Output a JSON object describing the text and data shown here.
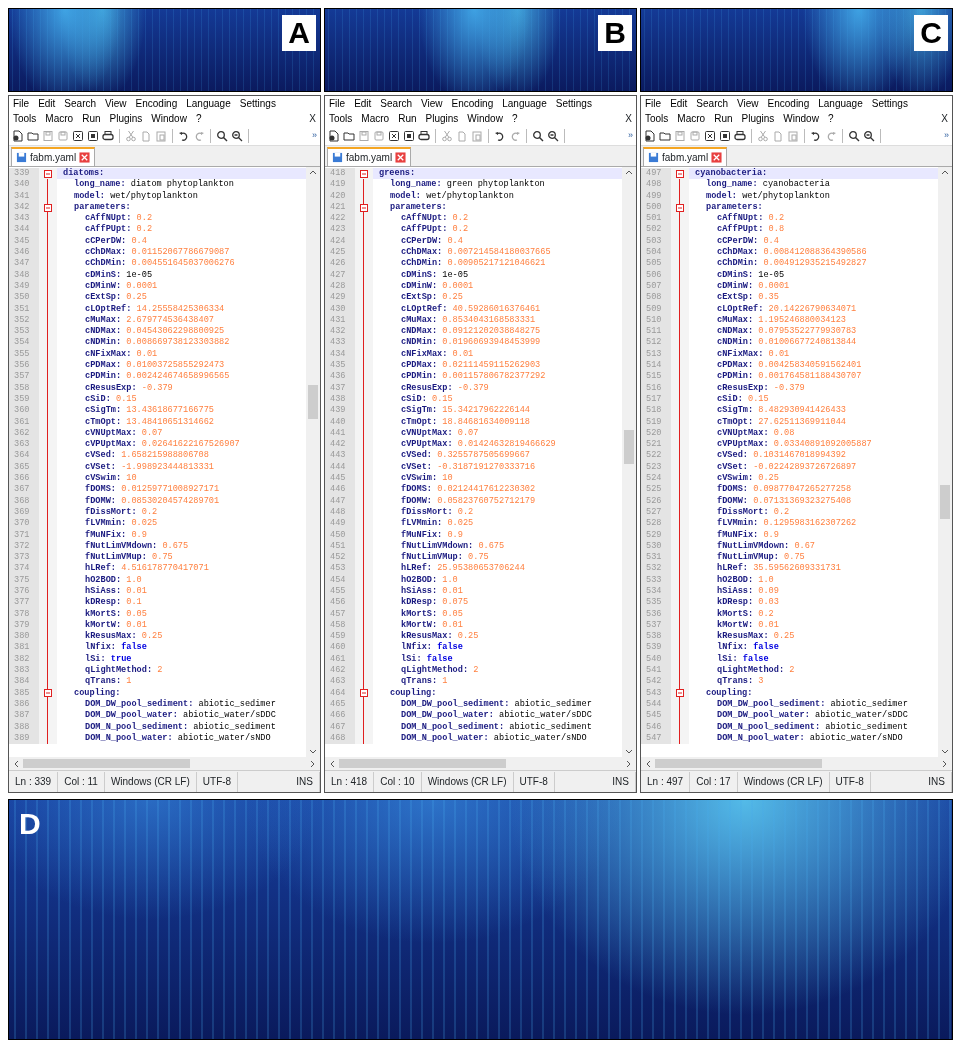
{
  "panels": [
    {
      "label": "A",
      "editor": {
        "menu_rows": [
          [
            "File",
            "Edit",
            "Search",
            "View",
            "Encoding",
            "Language",
            "Settings"
          ],
          [
            "Tools",
            "Macro",
            "Run",
            "Plugins",
            "Window",
            "?"
          ]
        ],
        "close": "X",
        "toolbar_more": "»",
        "tab": {
          "label": "fabm.yaml"
        },
        "code": {
          "num": "339",
          "key": "diatoms:",
          "kind": "section",
          "current": true,
          "children": [
            {
              "num": "340",
              "key": "long_name:",
              "value": "diatom phytoplankton",
              "kind": "text"
            },
            {
              "num": "341",
              "key": "model:",
              "value": "wet/phytoplankton",
              "kind": "text"
            },
            {
              "num": "342",
              "key": "parameters:",
              "kind": "section",
              "children": [
                {
                  "num": "343",
                  "key": "cAffNUpt:",
                  "value": "0.2",
                  "kind": "number"
                },
                {
                  "num": "344",
                  "key": "cAffPUpt:",
                  "value": "0.2",
                  "kind": "number"
                },
                {
                  "num": "345",
                  "key": "cCPerDW:",
                  "value": "0.4",
                  "kind": "number"
                },
                {
                  "num": "346",
                  "key": "cChDMax:",
                  "value": "0.01152067786679087",
                  "kind": "number"
                },
                {
                  "num": "347",
                  "key": "cChDMin:",
                  "value": "0.004551645037006276",
                  "kind": "number"
                },
                {
                  "num": "348",
                  "key": "cDMinS:",
                  "value": "1e-05",
                  "kind": "text"
                },
                {
                  "num": "349",
                  "key": "cDMinW:",
                  "value": "0.0001",
                  "kind": "number"
                },
                {
                  "num": "350",
                  "key": "cExtSp:",
                  "value": "0.25",
                  "kind": "number"
                },
                {
                  "num": "351",
                  "key": "cLOptRef:",
                  "value": "14.25558425306334",
                  "kind": "number"
                },
                {
                  "num": "352",
                  "key": "cMuMax:",
                  "value": "2.679774536438407",
                  "kind": "number"
                },
                {
                  "num": "353",
                  "key": "cNDMax:",
                  "value": "0.04543062298800925",
                  "kind": "number"
                },
                {
                  "num": "354",
                  "key": "cNDMin:",
                  "value": "0.008669738123303882",
                  "kind": "number"
                },
                {
                  "num": "355",
                  "key": "cNFixMax:",
                  "value": "0.01",
                  "kind": "number"
                },
                {
                  "num": "356",
                  "key": "cPDMax:",
                  "value": "0.01003725855292473",
                  "kind": "number"
                },
                {
                  "num": "357",
                  "key": "cPDMin:",
                  "value": "0.002424674658996565",
                  "kind": "number"
                },
                {
                  "num": "358",
                  "key": "cResusExp:",
                  "value": "-0.379",
                  "kind": "number"
                },
                {
                  "num": "359",
                  "key": "cSiD:",
                  "value": "0.15",
                  "kind": "number"
                },
                {
                  "num": "360",
                  "key": "cSigTm:",
                  "value": "13.43618677166775",
                  "kind": "number"
                },
                {
                  "num": "361",
                  "key": "cTmOpt:",
                  "value": "13.48410651314662",
                  "kind": "number"
                },
                {
                  "num": "362",
                  "key": "cVNUptMax:",
                  "value": "0.07",
                  "kind": "number"
                },
                {
                  "num": "363",
                  "key": "cVPUptMax:",
                  "value": "0.02641622167526907",
                  "kind": "number"
                },
                {
                  "num": "364",
                  "key": "cVSed:",
                  "value": "1.658215988806708",
                  "kind": "number"
                },
                {
                  "num": "365",
                  "key": "cVSet:",
                  "value": "-1.998923444813331",
                  "kind": "number"
                },
                {
                  "num": "366",
                  "key": "cVSwim:",
                  "value": "10",
                  "kind": "number"
                },
                {
                  "num": "367",
                  "key": "fDOMS:",
                  "value": "0.01259771008927171",
                  "kind": "number"
                },
                {
                  "num": "368",
                  "key": "fDOMW:",
                  "value": "0.08530204574289701",
                  "kind": "number"
                },
                {
                  "num": "369",
                  "key": "fDissMort:",
                  "value": "0.2",
                  "kind": "number"
                },
                {
                  "num": "370",
                  "key": "fLVMmin:",
                  "value": "0.025",
                  "kind": "number"
                },
                {
                  "num": "371",
                  "key": "fMuNFix:",
                  "value": "0.9",
                  "kind": "number"
                },
                {
                  "num": "372",
                  "key": "fNutLimVMdown:",
                  "value": "0.675",
                  "kind": "number"
                },
                {
                  "num": "373",
                  "key": "fNutLimVMup:",
                  "value": "0.75",
                  "kind": "number"
                },
                {
                  "num": "374",
                  "key": "hLRef:",
                  "value": "4.516178770417071",
                  "kind": "number"
                },
                {
                  "num": "375",
                  "key": "hO2BOD:",
                  "value": "1.0",
                  "kind": "number"
                },
                {
                  "num": "376",
                  "key": "hSiAss:",
                  "value": "0.01",
                  "kind": "number"
                },
                {
                  "num": "377",
                  "key": "kDResp:",
                  "value": "0.1",
                  "kind": "number"
                },
                {
                  "num": "378",
                  "key": "kMortS:",
                  "value": "0.05",
                  "kind": "number"
                },
                {
                  "num": "379",
                  "key": "kMortW:",
                  "value": "0.01",
                  "kind": "number"
                },
                {
                  "num": "380",
                  "key": "kResusMax:",
                  "value": "0.25",
                  "kind": "number"
                },
                {
                  "num": "381",
                  "key": "lNfix:",
                  "value": "false",
                  "kind": "bool"
                },
                {
                  "num": "382",
                  "key": "lSi:",
                  "value": "true",
                  "kind": "bool"
                },
                {
                  "num": "383",
                  "key": "qLightMethod:",
                  "value": "2",
                  "kind": "number"
                },
                {
                  "num": "384",
                  "key": "qTrans:",
                  "value": "1",
                  "kind": "number"
                }
              ]
            },
            {
              "num": "385",
              "key": "coupling:",
              "kind": "section",
              "children": [
                {
                  "num": "386",
                  "key": "DOM_DW_pool_sediment:",
                  "value": "abiotic_sedimer",
                  "kind": "text"
                },
                {
                  "num": "387",
                  "key": "DOM_DW_pool_water:",
                  "value": "abiotic_water/sDDC",
                  "kind": "text"
                },
                {
                  "num": "388",
                  "key": "DOM_N_pool_sediment:",
                  "value": "abiotic_sediment",
                  "kind": "text"
                },
                {
                  "num": "389",
                  "key": "DOM_N_pool_water:",
                  "value": "abiotic_water/sNDO",
                  "kind": "text"
                }
              ]
            }
          ]
        },
        "status": [
          "Ln : 339",
          "Col : 11",
          "Windows (CR LF)",
          "UTF-8",
          "INS"
        ]
      }
    },
    {
      "label": "B",
      "editor": {
        "menu_rows": [
          [
            "File",
            "Edit",
            "Search",
            "View",
            "Encoding",
            "Language",
            "Settings"
          ],
          [
            "Tools",
            "Macro",
            "Run",
            "Plugins",
            "Window",
            "?"
          ]
        ],
        "close": "X",
        "toolbar_more": "»",
        "tab": {
          "label": "fabm.yaml"
        },
        "code": {
          "num": "418",
          "key": "greens:",
          "kind": "section",
          "current": true,
          "children": [
            {
              "num": "419",
              "key": "long_name:",
              "value": "green phytoplankton",
              "kind": "text"
            },
            {
              "num": "420",
              "key": "model:",
              "value": "wet/phytoplankton",
              "kind": "text"
            },
            {
              "num": "421",
              "key": "parameters:",
              "kind": "section",
              "children": [
                {
                  "num": "422",
                  "key": "cAffNUpt:",
                  "value": "0.2",
                  "kind": "number"
                },
                {
                  "num": "423",
                  "key": "cAffPUpt:",
                  "value": "0.2",
                  "kind": "number"
                },
                {
                  "num": "424",
                  "key": "cCPerDW:",
                  "value": "0.4",
                  "kind": "number"
                },
                {
                  "num": "425",
                  "key": "cChDMax:",
                  "value": "0.007214584180037665",
                  "kind": "number"
                },
                {
                  "num": "426",
                  "key": "cChDMin:",
                  "value": "0.00905217121046621",
                  "kind": "number"
                },
                {
                  "num": "427",
                  "key": "cDMinS:",
                  "value": "1e-05",
                  "kind": "text"
                },
                {
                  "num": "428",
                  "key": "cDMinW:",
                  "value": "0.0001",
                  "kind": "number"
                },
                {
                  "num": "429",
                  "key": "cExtSp:",
                  "value": "0.25",
                  "kind": "number"
                },
                {
                  "num": "430",
                  "key": "cLOptRef:",
                  "value": "40.59286016376461",
                  "kind": "number"
                },
                {
                  "num": "431",
                  "key": "cMuMax:",
                  "value": "0.8534043168583331",
                  "kind": "number"
                },
                {
                  "num": "432",
                  "key": "cNDMax:",
                  "value": "0.09121202038848275",
                  "kind": "number"
                },
                {
                  "num": "433",
                  "key": "cNDMin:",
                  "value": "0.01960693948453999",
                  "kind": "number"
                },
                {
                  "num": "434",
                  "key": "cNFixMax:",
                  "value": "0.01",
                  "kind": "number"
                },
                {
                  "num": "435",
                  "key": "cPDMax:",
                  "value": "0.02111459115262903",
                  "kind": "number"
                },
                {
                  "num": "436",
                  "key": "cPDMin:",
                  "value": "0.001157806782377292",
                  "kind": "number"
                },
                {
                  "num": "437",
                  "key": "cResusExp:",
                  "value": "-0.379",
                  "kind": "number"
                },
                {
                  "num": "438",
                  "key": "cSiD:",
                  "value": "0.15",
                  "kind": "number"
                },
                {
                  "num": "439",
                  "key": "cSigTm:",
                  "value": "15.34217962226144",
                  "kind": "number"
                },
                {
                  "num": "440",
                  "key": "cTmOpt:",
                  "value": "18.84681634009118",
                  "kind": "number"
                },
                {
                  "num": "441",
                  "key": "cVNUptMax:",
                  "value": "0.07",
                  "kind": "number"
                },
                {
                  "num": "442",
                  "key": "cVPUptMax:",
                  "value": "0.01424632819466629",
                  "kind": "number"
                },
                {
                  "num": "443",
                  "key": "cVSed:",
                  "value": "0.3255787505699667",
                  "kind": "number"
                },
                {
                  "num": "444",
                  "key": "cVSet:",
                  "value": "-0.3187191270333716",
                  "kind": "number"
                },
                {
                  "num": "445",
                  "key": "cVSwim:",
                  "value": "10",
                  "kind": "number"
                },
                {
                  "num": "446",
                  "key": "fDOMS:",
                  "value": "0.02124417612230302",
                  "kind": "number"
                },
                {
                  "num": "447",
                  "key": "fDOMW:",
                  "value": "0.05823760752712179",
                  "kind": "number"
                },
                {
                  "num": "448",
                  "key": "fDissMort:",
                  "value": "0.2",
                  "kind": "number"
                },
                {
                  "num": "449",
                  "key": "fLVMmin:",
                  "value": "0.025",
                  "kind": "number"
                },
                {
                  "num": "450",
                  "key": "fMuNFix:",
                  "value": "0.9",
                  "kind": "number"
                },
                {
                  "num": "451",
                  "key": "fNutLimVMdown:",
                  "value": "0.675",
                  "kind": "number"
                },
                {
                  "num": "452",
                  "key": "fNutLimVMup:",
                  "value": "0.75",
                  "kind": "number"
                },
                {
                  "num": "453",
                  "key": "hLRef:",
                  "value": "25.95380653706244",
                  "kind": "number"
                },
                {
                  "num": "454",
                  "key": "hO2BOD:",
                  "value": "1.0",
                  "kind": "number"
                },
                {
                  "num": "455",
                  "key": "hSiAss:",
                  "value": "0.01",
                  "kind": "number"
                },
                {
                  "num": "456",
                  "key": "kDResp:",
                  "value": "0.075",
                  "kind": "number"
                },
                {
                  "num": "457",
                  "key": "kMortS:",
                  "value": "0.05",
                  "kind": "number"
                },
                {
                  "num": "458",
                  "key": "kMortW:",
                  "value": "0.01",
                  "kind": "number"
                },
                {
                  "num": "459",
                  "key": "kResusMax:",
                  "value": "0.25",
                  "kind": "number"
                },
                {
                  "num": "460",
                  "key": "lNfix:",
                  "value": "false",
                  "kind": "bool"
                },
                {
                  "num": "461",
                  "key": "lSi:",
                  "value": "false",
                  "kind": "bool"
                },
                {
                  "num": "462",
                  "key": "qLightMethod:",
                  "value": "2",
                  "kind": "number"
                },
                {
                  "num": "463",
                  "key": "qTrans:",
                  "value": "1",
                  "kind": "number"
                }
              ]
            },
            {
              "num": "464",
              "key": "coupling:",
              "kind": "section",
              "children": [
                {
                  "num": "465",
                  "key": "DOM_DW_pool_sediment:",
                  "value": "abiotic_sedimer",
                  "kind": "text"
                },
                {
                  "num": "466",
                  "key": "DOM_DW_pool_water:",
                  "value": "abiotic_water/sDDC",
                  "kind": "text"
                },
                {
                  "num": "467",
                  "key": "DOM_N_pool_sediment:",
                  "value": "abiotic_sediment",
                  "kind": "text"
                },
                {
                  "num": "468",
                  "key": "DOM_N_pool_water:",
                  "value": "abiotic_water/sNDO",
                  "kind": "text"
                }
              ]
            }
          ]
        },
        "status": [
          "Ln : 418",
          "Col : 10",
          "Windows (CR LF)",
          "UTF-8",
          "INS"
        ]
      }
    },
    {
      "label": "C",
      "editor": {
        "menu_rows": [
          [
            "File",
            "Edit",
            "Search",
            "View",
            "Encoding",
            "Language",
            "Settings"
          ],
          [
            "Tools",
            "Macro",
            "Run",
            "Plugins",
            "Window",
            "?"
          ]
        ],
        "close": "X",
        "toolbar_more": "»",
        "tab": {
          "label": "fabm.yaml"
        },
        "code": {
          "num": "497",
          "key": "cyanobacteria:",
          "kind": "section",
          "current": true,
          "children": [
            {
              "num": "498",
              "key": "long_name:",
              "value": "cyanobacteria",
              "kind": "text"
            },
            {
              "num": "499",
              "key": "model:",
              "value": "wet/phytoplankton",
              "kind": "text"
            },
            {
              "num": "500",
              "key": "parameters:",
              "kind": "section",
              "children": [
                {
                  "num": "501",
                  "key": "cAffNUpt:",
                  "value": "0.2",
                  "kind": "number"
                },
                {
                  "num": "502",
                  "key": "cAffPUpt:",
                  "value": "0.8",
                  "kind": "number"
                },
                {
                  "num": "503",
                  "key": "cCPerDW:",
                  "value": "0.4",
                  "kind": "number"
                },
                {
                  "num": "504",
                  "key": "cChDMax:",
                  "value": "0.008412088364390586",
                  "kind": "number"
                },
                {
                  "num": "505",
                  "key": "cChDMin:",
                  "value": "0.004912935215492827",
                  "kind": "number"
                },
                {
                  "num": "506",
                  "key": "cDMinS:",
                  "value": "1e-05",
                  "kind": "text"
                },
                {
                  "num": "507",
                  "key": "cDMinW:",
                  "value": "0.0001",
                  "kind": "number"
                },
                {
                  "num": "508",
                  "key": "cExtSp:",
                  "value": "0.35",
                  "kind": "number"
                },
                {
                  "num": "509",
                  "key": "cLOptRef:",
                  "value": "20.14226790634071",
                  "kind": "number"
                },
                {
                  "num": "510",
                  "key": "cMuMax:",
                  "value": "1.195246880034123",
                  "kind": "number"
                },
                {
                  "num": "511",
                  "key": "cNDMax:",
                  "value": "0.07953522779930783",
                  "kind": "number"
                },
                {
                  "num": "512",
                  "key": "cNDMin:",
                  "value": "0.01006677240813844",
                  "kind": "number"
                },
                {
                  "num": "513",
                  "key": "cNFixMax:",
                  "value": "0.01",
                  "kind": "number"
                },
                {
                  "num": "514",
                  "key": "cPDMax:",
                  "value": "0.004258340591562401",
                  "kind": "number"
                },
                {
                  "num": "515",
                  "key": "cPDMin:",
                  "value": "0.001764581188430707",
                  "kind": "number"
                },
                {
                  "num": "516",
                  "key": "cResusExp:",
                  "value": "-0.379",
                  "kind": "number"
                },
                {
                  "num": "517",
                  "key": "cSiD:",
                  "value": "0.15",
                  "kind": "number"
                },
                {
                  "num": "518",
                  "key": "cSigTm:",
                  "value": "8.482930941426433",
                  "kind": "number"
                },
                {
                  "num": "519",
                  "key": "cTmOpt:",
                  "value": "27.62511369911044",
                  "kind": "number"
                },
                {
                  "num": "520",
                  "key": "cVNUptMax:",
                  "value": "0.08",
                  "kind": "number"
                },
                {
                  "num": "521",
                  "key": "cVPUptMax:",
                  "value": "0.03340891092005887",
                  "kind": "number"
                },
                {
                  "num": "522",
                  "key": "cVSed:",
                  "value": "0.1031467018994392",
                  "kind": "number"
                },
                {
                  "num": "523",
                  "key": "cVSet:",
                  "value": "-0.02242893726726897",
                  "kind": "number"
                },
                {
                  "num": "524",
                  "key": "cVSwim:",
                  "value": "0.25",
                  "kind": "number"
                },
                {
                  "num": "525",
                  "key": "fDOMS:",
                  "value": "0.09877047265277258",
                  "kind": "number"
                },
                {
                  "num": "526",
                  "key": "fDOMW:",
                  "value": "0.07131369323275408",
                  "kind": "number"
                },
                {
                  "num": "527",
                  "key": "fDissMort:",
                  "value": "0.2",
                  "kind": "number"
                },
                {
                  "num": "528",
                  "key": "fLVMmin:",
                  "value": "0.1295983162307262",
                  "kind": "number"
                },
                {
                  "num": "529",
                  "key": "fMuNFix:",
                  "value": "0.9",
                  "kind": "number"
                },
                {
                  "num": "530",
                  "key": "fNutLimVMdown:",
                  "value": "0.67",
                  "kind": "number"
                },
                {
                  "num": "531",
                  "key": "fNutLimVMup:",
                  "value": "0.75",
                  "kind": "number"
                },
                {
                  "num": "532",
                  "key": "hLRef:",
                  "value": "35.59562609331731",
                  "kind": "number"
                },
                {
                  "num": "533",
                  "key": "hO2BOD:",
                  "value": "1.0",
                  "kind": "number"
                },
                {
                  "num": "534",
                  "key": "hSiAss:",
                  "value": "0.09",
                  "kind": "number"
                },
                {
                  "num": "535",
                  "key": "kDResp:",
                  "value": "0.03",
                  "kind": "number"
                },
                {
                  "num": "536",
                  "key": "kMortS:",
                  "value": "0.2",
                  "kind": "number"
                },
                {
                  "num": "537",
                  "key": "kMortW:",
                  "value": "0.01",
                  "kind": "number"
                },
                {
                  "num": "538",
                  "key": "kResusMax:",
                  "value": "0.25",
                  "kind": "number"
                },
                {
                  "num": "539",
                  "key": "lNfix:",
                  "value": "false",
                  "kind": "bool"
                },
                {
                  "num": "540",
                  "key": "lSi:",
                  "value": "false",
                  "kind": "bool"
                },
                {
                  "num": "541",
                  "key": "qLightMethod:",
                  "value": "2",
                  "kind": "number"
                },
                {
                  "num": "542",
                  "key": "qTrans:",
                  "value": "3",
                  "kind": "number"
                }
              ]
            },
            {
              "num": "543",
              "key": "coupling:",
              "kind": "section",
              "children": [
                {
                  "num": "544",
                  "key": "DOM_DW_pool_sediment:",
                  "value": "abiotic_sedimer",
                  "kind": "text"
                },
                {
                  "num": "545",
                  "key": "DOM_DW_pool_water:",
                  "value": "abiotic_water/sDDC",
                  "kind": "text"
                },
                {
                  "num": "546",
                  "key": "DOM_N_pool_sediment:",
                  "value": "abiotic_sediment",
                  "kind": "text"
                },
                {
                  "num": "547",
                  "key": "DOM_N_pool_water:",
                  "value": "abiotic_water/sNDO",
                  "kind": "text"
                }
              ]
            }
          ]
        },
        "status": [
          "Ln : 497",
          "Col : 17",
          "Windows (CR LF)",
          "UTF-8",
          "INS"
        ]
      }
    }
  ],
  "bottom_panel": {
    "label": "D"
  }
}
